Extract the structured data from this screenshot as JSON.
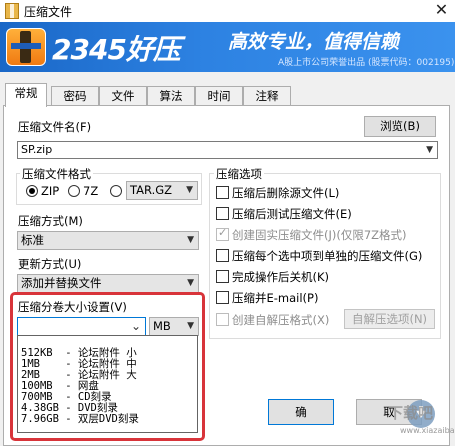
{
  "window": {
    "title": "压缩文件",
    "close_glyph": "✕"
  },
  "banner": {
    "brand": "2345好压",
    "slogan": "高效专业，值得信赖",
    "stock_info": "A股上市公司荣誉出品 (股票代码：002195)"
  },
  "tabs": [
    "常规",
    "密码",
    "文件",
    "算法",
    "时间",
    "注释"
  ],
  "active_tab": "常规",
  "archive_name": {
    "label": "压缩文件名(F)",
    "value": "SP.zip",
    "browse_label": "浏览(B)"
  },
  "format": {
    "title": "压缩文件格式",
    "options": [
      {
        "label": "ZIP",
        "selected": true
      },
      {
        "label": "7Z",
        "selected": false
      },
      {
        "label": "TAR.GZ",
        "selected": false
      }
    ]
  },
  "method": {
    "label": "压缩方式(M)",
    "value": "标准"
  },
  "update": {
    "label": "更新方式(U)",
    "value": "添加并替换文件"
  },
  "volume": {
    "label": "压缩分卷大小设置(V)",
    "value": "",
    "unit": "MB",
    "options": [
      "512KB  - 论坛附件 小",
      "1MB    - 论坛附件 中",
      "2MB    - 论坛附件 大",
      "100MB  - 网盘",
      "700MB  - CD刻录",
      "4.38GB - DVD刻录",
      "7.96GB - 双层DVD刻录"
    ]
  },
  "options_group": {
    "title": "压缩选项",
    "items": [
      {
        "label": "压缩后删除源文件(L)",
        "checked": false,
        "disabled": false
      },
      {
        "label": "压缩后测试压缩文件(E)",
        "checked": false,
        "disabled": false
      },
      {
        "label": "创建固实压缩文件(J)(仅限7Z格式)",
        "checked": true,
        "disabled": true
      },
      {
        "label": "压缩每个选中项到单独的压缩文件(G)",
        "checked": false,
        "disabled": false
      },
      {
        "label": "完成操作后关机(K)",
        "checked": false,
        "disabled": false
      },
      {
        "label": "压缩并E-mail(P)",
        "checked": false,
        "disabled": false
      },
      {
        "label": "创建自解压格式(X)",
        "checked": false,
        "disabled": true
      }
    ],
    "sfx_button": "自解压选项(N)"
  },
  "buttons": {
    "ok_partial": "确",
    "cancel_partial": "取"
  },
  "watermark": {
    "text": "下载吧",
    "url": "www.xiazaiba.com"
  }
}
